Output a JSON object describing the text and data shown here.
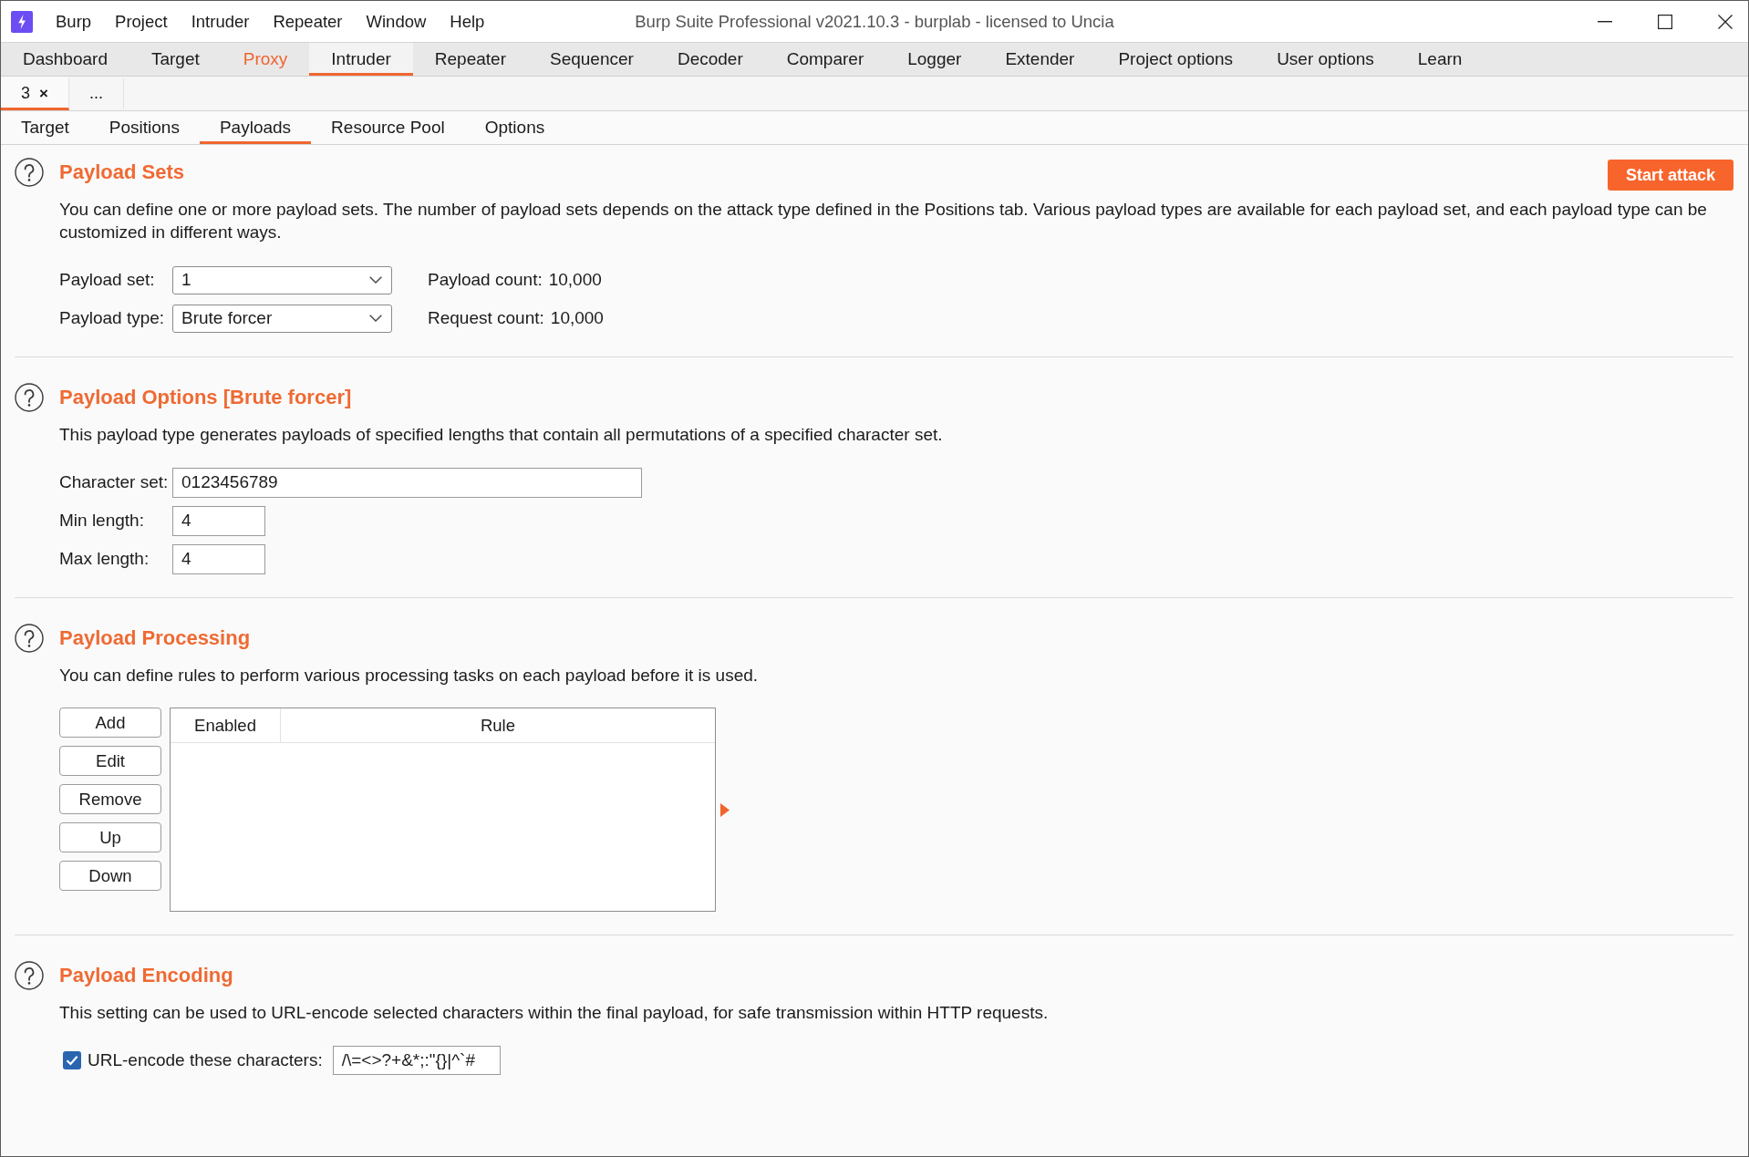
{
  "window": {
    "title": "Burp Suite Professional v2021.10.3 - burplab - licensed to Uncia"
  },
  "menu_bar": [
    "Burp",
    "Project",
    "Intruder",
    "Repeater",
    "Window",
    "Help"
  ],
  "main_tabs": [
    {
      "label": "Dashboard",
      "selected": false,
      "highlighted": false
    },
    {
      "label": "Target",
      "selected": false,
      "highlighted": false
    },
    {
      "label": "Proxy",
      "selected": false,
      "highlighted": true
    },
    {
      "label": "Intruder",
      "selected": true,
      "highlighted": false
    },
    {
      "label": "Repeater",
      "selected": false,
      "highlighted": false
    },
    {
      "label": "Sequencer",
      "selected": false,
      "highlighted": false
    },
    {
      "label": "Decoder",
      "selected": false,
      "highlighted": false
    },
    {
      "label": "Comparer",
      "selected": false,
      "highlighted": false
    },
    {
      "label": "Logger",
      "selected": false,
      "highlighted": false
    },
    {
      "label": "Extender",
      "selected": false,
      "highlighted": false
    },
    {
      "label": "Project options",
      "selected": false,
      "highlighted": false
    },
    {
      "label": "User options",
      "selected": false,
      "highlighted": false
    },
    {
      "label": "Learn",
      "selected": false,
      "highlighted": false
    }
  ],
  "attack_tabs": [
    {
      "label": "3",
      "close": "×",
      "selected": true
    },
    {
      "label": "...",
      "selected": false
    }
  ],
  "sub_tabs": [
    {
      "label": "Target",
      "selected": false
    },
    {
      "label": "Positions",
      "selected": false
    },
    {
      "label": "Payloads",
      "selected": true
    },
    {
      "label": "Resource Pool",
      "selected": false
    },
    {
      "label": "Options",
      "selected": false
    }
  ],
  "payload_sets": {
    "title": "Payload Sets",
    "action": "Start attack",
    "description": "You can define one or more payload sets. The number of payload sets depends on the attack type defined in the Positions tab. Various payload types are available for each payload set, and each payload type can be customized in different ways.",
    "selectors": [
      {
        "label": "Payload set:",
        "value": "1"
      },
      {
        "label": "Payload type:",
        "value": "Brute forcer"
      }
    ],
    "counts": [
      {
        "label": "Payload count:",
        "value": "10,000"
      },
      {
        "label": "Request count:",
        "value": "10,000"
      }
    ]
  },
  "payload_options": {
    "title": "Payload Options [Brute forcer]",
    "description": "This payload type generates payloads of specified lengths that contain all permutations of a specified character set.",
    "fields": [
      {
        "label": "Character set:",
        "value": "0123456789",
        "kind": "text"
      },
      {
        "label": "Min length:",
        "value": "4",
        "kind": "number"
      },
      {
        "label": "Max length:",
        "value": "4",
        "kind": "number"
      }
    ]
  },
  "payload_processing": {
    "title": "Payload Processing",
    "description": "You can define rules to perform various processing tasks on each payload before it is used.",
    "buttons": [
      "Add",
      "Edit",
      "Remove",
      "Up",
      "Down"
    ],
    "table": {
      "columns": [
        "Enabled",
        "Rule"
      ]
    }
  },
  "payload_encoding": {
    "title": "Payload Encoding",
    "description": "This setting can be used to URL-encode selected characters within the final payload, for safe transmission within HTTP requests.",
    "url_encode": {
      "label": "URL-encode these characters:",
      "checked": true,
      "value": "/\\=<>?+&*;:\"{}|^`#"
    }
  }
}
